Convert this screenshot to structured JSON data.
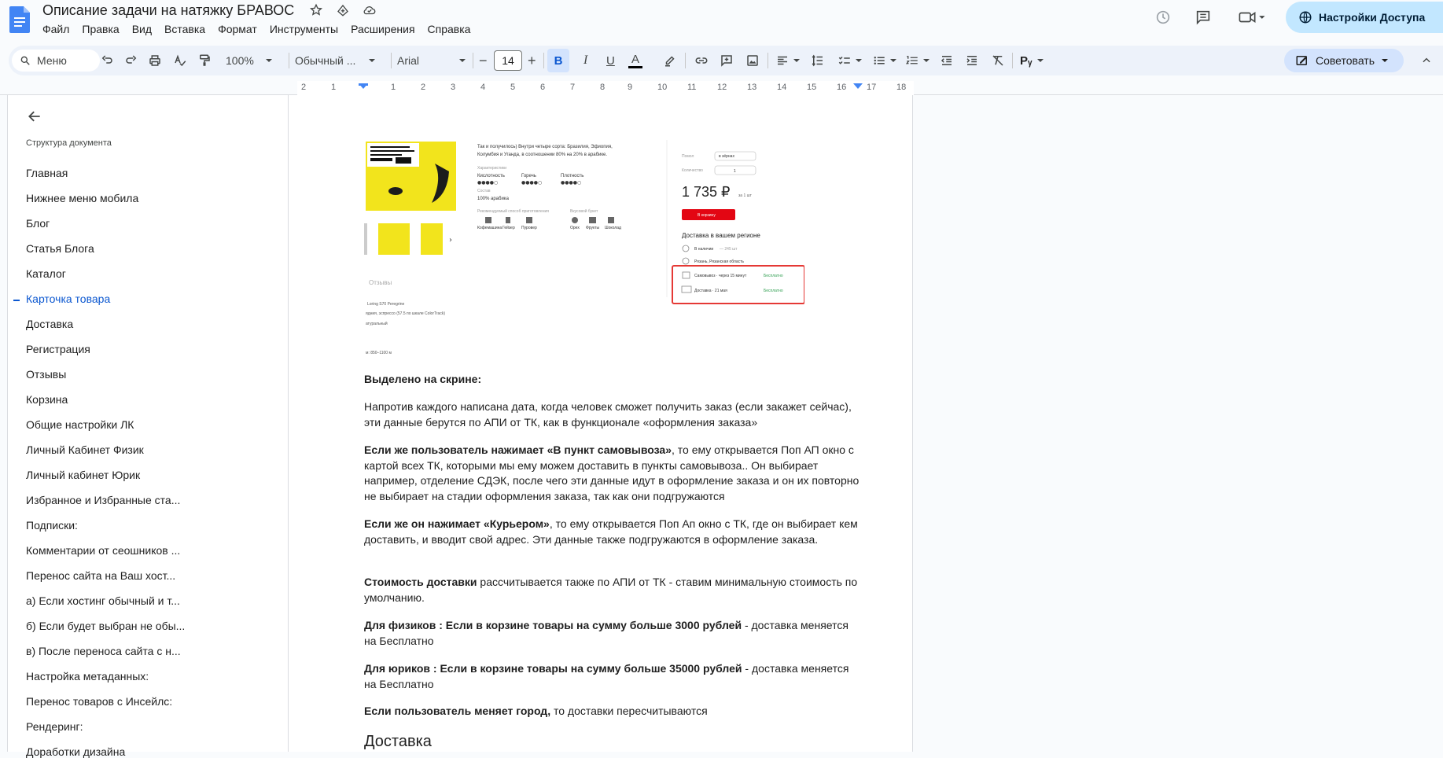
{
  "document": {
    "title": "Описание задачи на натяжку БРАВОС"
  },
  "menu": [
    "Файл",
    "Правка",
    "Вид",
    "Вставка",
    "Формат",
    "Инструменты",
    "Расширения",
    "Справка"
  ],
  "header": {
    "share_label": "Настройки Доступа"
  },
  "toolbar": {
    "menu_search": "Меню",
    "zoom": "100%",
    "style": "Обычный ...",
    "font": "Arial",
    "font_size": "14",
    "bold": "B",
    "italic": "I",
    "underline": "U",
    "text_color": "A",
    "advise_label": "Советовать"
  },
  "ruler": [
    "2",
    "1",
    "1",
    "2",
    "3",
    "4",
    "5",
    "6",
    "7",
    "8",
    "9",
    "10",
    "11",
    "12",
    "13",
    "14",
    "15",
    "16",
    "17",
    "18"
  ],
  "outline": {
    "title": "Структура документа",
    "items": [
      "Главная",
      "Нижнее меню мобила",
      "Блог",
      "Статья Блога",
      "Каталог",
      "Карточка товара",
      "Доставка",
      "Регистрация",
      "Отзывы",
      "Корзина",
      "Общие настройки ЛК",
      "Личный Кабинет Физик",
      "Личный кабинет Юрик",
      "Избранное и Избранные ста...",
      "Подписки:",
      "Комментарии от сеошников ...",
      "Перенос сайта на Ваш хост...",
      "а) Если хостинг обычный и т...",
      "б) Если будет выбран не обы...",
      "в) После переноса сайта с н...",
      "Настройка метаданных:",
      "Перенос товаров с Инсейлс:",
      "Рендеринг:",
      "Доработки дизайна"
    ],
    "active_index": 5
  },
  "screenshot": {
    "desc_line1": "Так и получилось) Внутри четыре сорта: Бразилия, Эфиопия,",
    "desc_line2": "Колумбия и Уганда, в соотношении 80% на 20% в арабике.",
    "char_heading": "Характеристики",
    "chars": [
      "Кислотность",
      "Горечь",
      "Плотность"
    ],
    "composition_heading": "Состав",
    "composition": "100% арабика",
    "brew_heading": "Рекомендуемый способ приготовления",
    "brew": [
      "Кофемашина",
      "Гейзер",
      "Пуровер"
    ],
    "taste_heading": "Вкусовой букет",
    "taste": [
      "Орех",
      "Фрукты",
      "Шоколад"
    ],
    "grind_label": "Помол",
    "grind_value": "в зёрнах",
    "qty_label": "Количество",
    "qty_value": "1",
    "price": "1 735 ₽",
    "price_unit": "за 1 шт",
    "cart_button": "В корзину",
    "delivery_heading": "Доставка в вашем регионе",
    "stock": "В наличии",
    "stock_count": "— 245 шт",
    "city": "Рязань, Рязанская область",
    "pickup": "Самовывоз · через 15 минут",
    "pickup_price": "Бесплатно",
    "courier": "Доставка · 21 мая",
    "courier_price": "Бесплатно",
    "reviews": "Отзывы",
    "spec1": "Loring S70 Peregrine",
    "spec2": "ядния, эспрессо (57.5 по шкале ColorTrack)",
    "spec3": "атуральный",
    "spec4": "м: 850–1100 м"
  },
  "body": {
    "highlighted_label": "Выделено на скрине:",
    "p1": "Напротив каждого написана дата, когда человек сможет получить заказ (если закажет сейчас), эти данные берутся по АПИ от ТК, как в функционале «оформления заказа»",
    "p2_bold": "Если же пользователь нажимает «В пункт самовывоза»",
    "p2_rest": ", то ему открывается Поп АП окно с картой всех ТК, которыми мы ему можем доставить в пункты самовывоза.. Он выбирает например, отделение СДЭК, после чего эти данные идут в оформление заказа и он их повторно не выбирает на стадии оформления заказа, так как они подгружаются",
    "p3_bold": "Если же он нажимает «Курьером»",
    "p3_rest": ", то ему открывается Поп Ап окно с  ТК, где он выбирает кем доставить, и вводит свой адрес. Эти данные также подгружаются в оформление заказа.",
    "p4_bold": "Стоимость доставки",
    "p4_rest": " рассчитывается также по АПИ от ТК - ставим минимальную стоимость по умолчанию.",
    "p5_bold": "Для физиков : Если в корзине товары на сумму больше 3000 рублей",
    "p5_rest": " - доставка меняется на Бесплатно",
    "p6_bold": "Для юриков : Если в корзине товары на сумму больше 35000 рублей",
    "p6_rest": " - доставка меняется на Бесплатно",
    "p7_bold": "Если пользователь меняет город,",
    "p7_rest": " то доставки пересчитываются",
    "heading": "Доставка"
  },
  "colors": {
    "accent": "#0b57d0",
    "share_bg": "#c2e7ff",
    "toolbar_bg": "#edf2fa",
    "highlight_box": "#e53935",
    "cart_red": "#e30613",
    "product_yellow": "#f2e41c"
  }
}
